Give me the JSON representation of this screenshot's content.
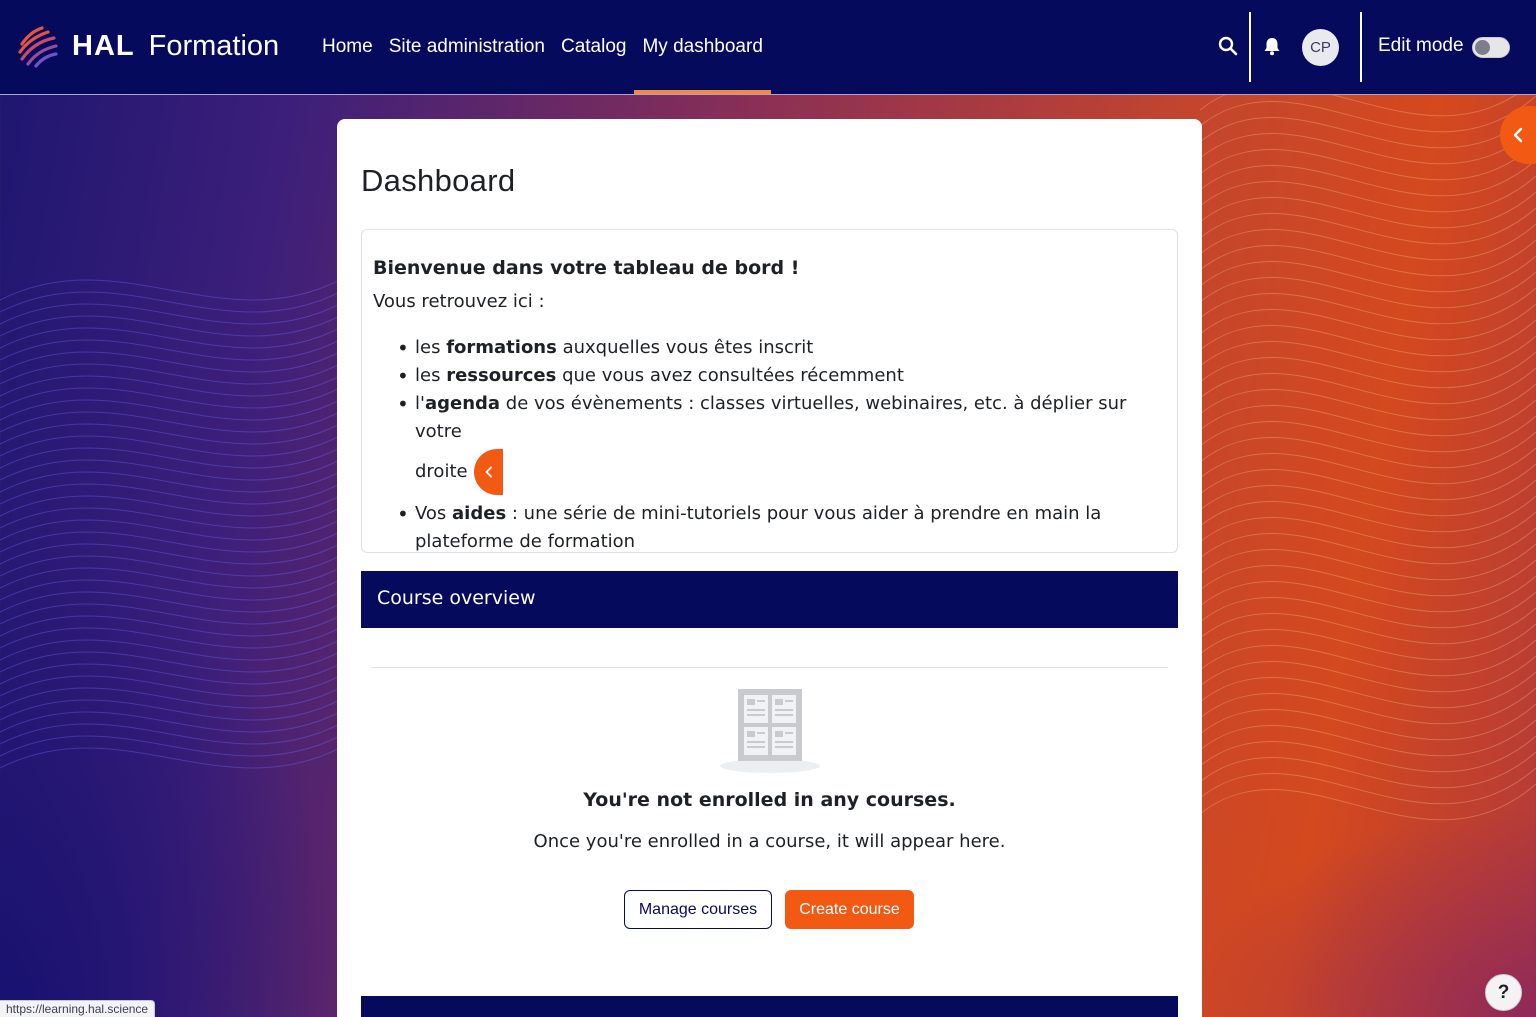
{
  "brand": {
    "name": "HAL",
    "sub": "Formation"
  },
  "nav": {
    "links": [
      "Home",
      "Site administration",
      "Catalog",
      "My dashboard"
    ],
    "active": "My dashboard",
    "avatar_initials": "CP",
    "edit_mode_label": "Edit mode"
  },
  "page": {
    "title": "Dashboard",
    "welcome": {
      "title": "Bienvenue dans votre tableau de bord !",
      "subtitle": "Vous retrouvez ici :",
      "items": [
        {
          "pre": "les ",
          "bold": "formations",
          "post": " auxquelles vous êtes inscrit"
        },
        {
          "pre": "les ",
          "bold": "ressources",
          "post": " que vous avez consultées récemment"
        },
        {
          "pre": "l'",
          "bold": "agenda",
          "post": " de vos évènements : classes virtuelles, webinaires, etc. à déplier sur votre",
          "post2": "droite"
        },
        {
          "pre": "Vos ",
          "bold": "aides",
          "post": " : une série de mini-tutoriels pour vous aider à prendre en main la plateforme de formation"
        }
      ]
    },
    "course_overview": {
      "title": "Course overview",
      "empty_title": "You're not enrolled in any courses.",
      "empty_subtitle": "Once you're enrolled in a course, it will appear here.",
      "manage_label": "Manage courses",
      "create_label": "Create course"
    }
  },
  "status_url": "https://learning.hal.science",
  "help_label": "?",
  "colors": {
    "navy": "#060a5c",
    "accent": "#f25a14",
    "active_underline": "#f08a4b"
  },
  "icons": [
    "hal-logo-icon",
    "search-icon",
    "bell-icon",
    "chevron-left-icon",
    "courses-empty-icon"
  ]
}
